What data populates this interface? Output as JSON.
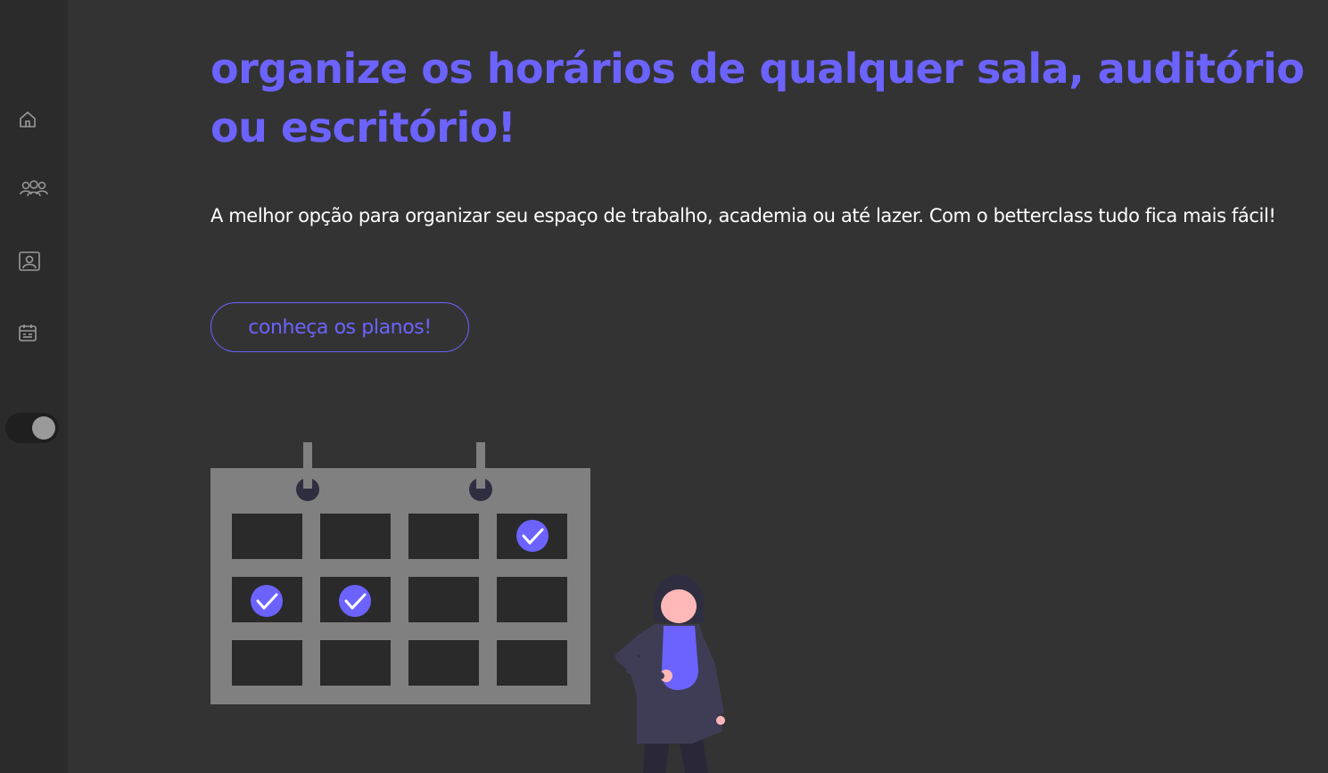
{
  "sidebar": {
    "items": [
      {
        "icon": "home-icon"
      },
      {
        "icon": "users-icon"
      },
      {
        "icon": "contact-card-icon"
      },
      {
        "icon": "calendar-icon"
      }
    ],
    "theme_toggle": {
      "state": "dark"
    }
  },
  "hero": {
    "headline": "organize os horários de qualquer sala, auditório ou escritório!",
    "subtext": "A melhor opção para organizar seu espaço de trabalho, academia ou até lazer. Com o betterclass tudo fica mais fácil!",
    "cta_label": "conheça os planos!"
  },
  "colors": {
    "accent": "#6c63ff",
    "background": "#333333",
    "sidebar": "#2b2b2b",
    "text": "#ffffff"
  }
}
